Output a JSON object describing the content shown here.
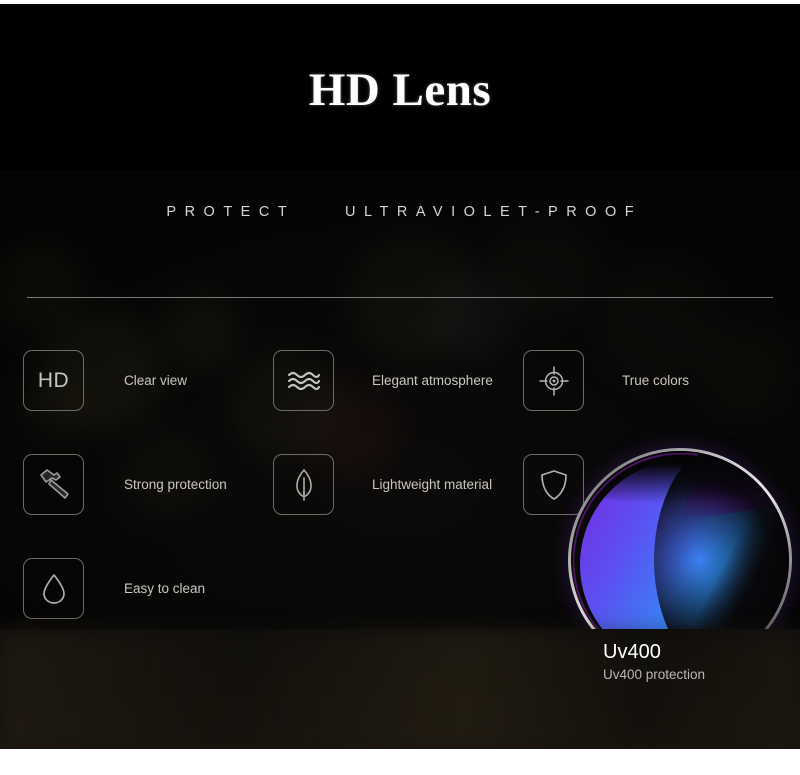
{
  "hero": {
    "title": "HD Lens"
  },
  "panel": {
    "subtitle": "PROTECT    ULTRAVIOLET-PROOF"
  },
  "features": [
    {
      "icon": "hd-icon",
      "icon_text": "HD",
      "label": "Clear view"
    },
    {
      "icon": "waves-icon",
      "icon_text": "",
      "label": "Elegant atmosphere"
    },
    {
      "icon": "crosshair-icon",
      "icon_text": "",
      "label": "True colors"
    },
    {
      "icon": "hammer-icon",
      "icon_text": "",
      "label": "Strong protection"
    },
    {
      "icon": "leaf-icon",
      "icon_text": "",
      "label": "Lightweight material"
    },
    {
      "icon": "shield-icon",
      "icon_text": "",
      "label": "Uv400 protection"
    },
    {
      "icon": "droplet-icon",
      "icon_text": "",
      "label": "Easy to clean"
    }
  ],
  "uv_callout": {
    "title": "Uv400",
    "subtitle": "Uv400 protection"
  },
  "colors": {
    "background": "#0e0d0c",
    "hero_background": "#000000",
    "title_text": "#ffffff",
    "label_text": "#c9c6c2",
    "icon_border": "#6d6b68",
    "divider": "#8e8e8e",
    "lens_purple": "#8420e6",
    "lens_blue": "#3f7bf5"
  }
}
